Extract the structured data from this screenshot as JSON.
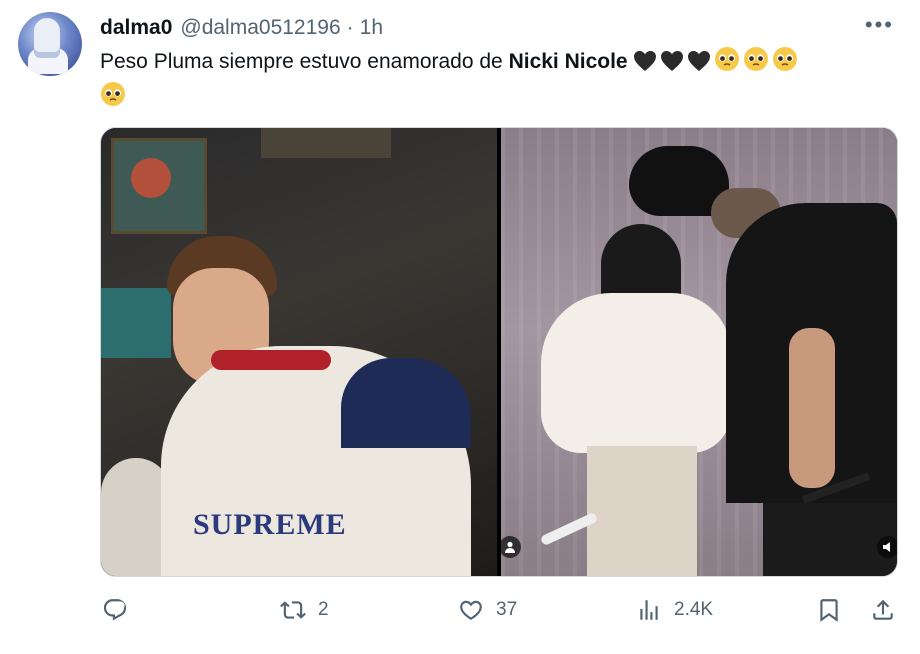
{
  "tweet": {
    "display_name": "dalma0",
    "handle": "@dalma0512196",
    "separator": "·",
    "time": "1h",
    "more_label": "•••",
    "text_before": "Peso Pluma siempre estuvo enamorado de ",
    "text_bold": "Nicki Nicole",
    "emojis": [
      "black-heart",
      "black-heart",
      "black-heart",
      "pleading-face",
      "pleading-face",
      "pleading-face",
      "pleading-face"
    ]
  },
  "media": {
    "left_photo_text": "SUPREME"
  },
  "actions": {
    "reply_count": "",
    "retweet_count": "2",
    "like_count": "37",
    "views_count": "2.4K"
  },
  "colors": {
    "text": "#0f1419",
    "muted": "#536471",
    "border": "#cfd9de"
  }
}
